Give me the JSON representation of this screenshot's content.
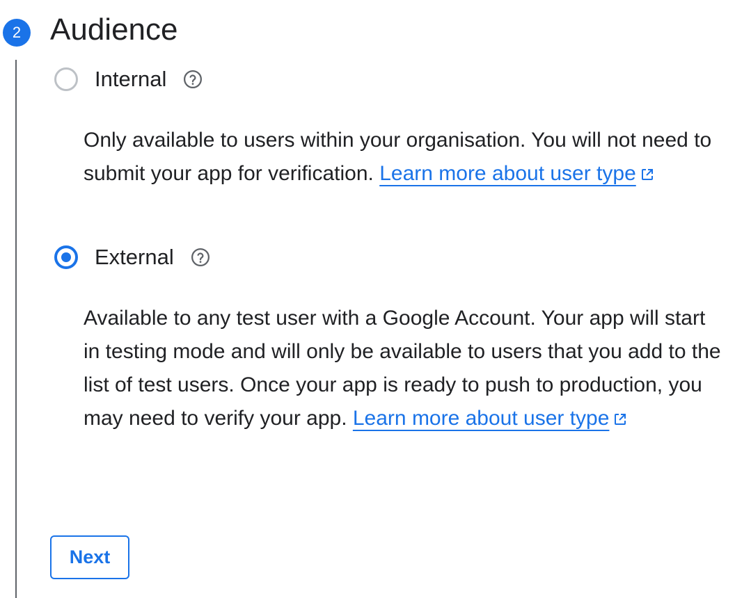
{
  "step": {
    "number": "2",
    "title": "Audience"
  },
  "options": [
    {
      "label": "Internal",
      "selected": false,
      "description": "Only available to users within your organisation. You will not need to submit your app for verification.",
      "link_text": "Learn more about user type",
      "help_icon": "help-circle-icon",
      "link_icon": "open-in-new-icon"
    },
    {
      "label": "External",
      "selected": true,
      "description": "Available to any test user with a Google Account. Your app will start in testing mode and will only be available to users that you add to the list of test users. Once your app is ready to push to production, you may need to verify your app.",
      "link_text": "Learn more about user type",
      "help_icon": "help-circle-icon",
      "link_icon": "open-in-new-icon"
    }
  ],
  "actions": {
    "next_label": "Next"
  },
  "colors": {
    "accent": "#1a73e8",
    "text": "#202124",
    "radio_unchecked": "#bdc1c6",
    "icon": "#5f6368"
  }
}
